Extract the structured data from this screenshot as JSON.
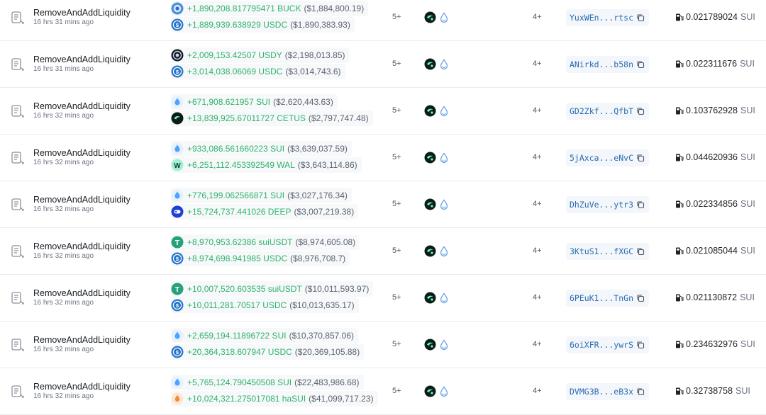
{
  "table": {
    "rows": [
      {
        "type": "RemoveAndAddLiquidity",
        "time": "16 hrs 31 mins ago",
        "changes": [
          {
            "amount": "+1,890,208.817795471 BUCK",
            "usd": "($1,884,800.19)",
            "coin": "buck"
          },
          {
            "amount": "+1,889,939.638929 USDC",
            "usd": "($1,890,383.93)",
            "coin": "usdc"
          }
        ],
        "count_a": "5+",
        "count_b": "4+",
        "sender": "YuxWEn...rtsc",
        "gas": "0.021789024",
        "gas_unit": "SUI"
      },
      {
        "type": "RemoveAndAddLiquidity",
        "time": "16 hrs 31 mins ago",
        "changes": [
          {
            "amount": "+2,009,153.42507 USDY",
            "usd": "($2,198,013.85)",
            "coin": "usdy"
          },
          {
            "amount": "+3,014,038.06069 USDC",
            "usd": "($3,014,743.6)",
            "coin": "usdc"
          }
        ],
        "count_a": "5+",
        "count_b": "4+",
        "sender": "ANirkd...b58n",
        "gas": "0.022311676",
        "gas_unit": "SUI"
      },
      {
        "type": "RemoveAndAddLiquidity",
        "time": "16 hrs 32 mins ago",
        "changes": [
          {
            "amount": "+671,908.621957 SUI",
            "usd": "($2,620,443.63)",
            "coin": "sui"
          },
          {
            "amount": "+13,839,925.67011727 CETUS",
            "usd": "($2,797,747.48)",
            "coin": "cetus"
          }
        ],
        "count_a": "5+",
        "count_b": "4+",
        "sender": "GD2Zkf...QfbT",
        "gas": "0.103762928",
        "gas_unit": "SUI"
      },
      {
        "type": "RemoveAndAddLiquidity",
        "time": "16 hrs 32 mins ago",
        "changes": [
          {
            "amount": "+933,086.561660223 SUI",
            "usd": "($3,639,037.59)",
            "coin": "sui"
          },
          {
            "amount": "+6,251,112.453392549 WAL",
            "usd": "($3,643,114.86)",
            "coin": "wal"
          }
        ],
        "count_a": "5+",
        "count_b": "4+",
        "sender": "5jAxca...eNvC",
        "gas": "0.044620936",
        "gas_unit": "SUI"
      },
      {
        "type": "RemoveAndAddLiquidity",
        "time": "16 hrs 32 mins ago",
        "changes": [
          {
            "amount": "+776,199.062566871 SUI",
            "usd": "($3,027,176.34)",
            "coin": "sui"
          },
          {
            "amount": "+15,724,737.441026 DEEP",
            "usd": "($3,007,219.38)",
            "coin": "deep"
          }
        ],
        "count_a": "5+",
        "count_b": "4+",
        "sender": "DhZuVe...ytr3",
        "gas": "0.022334856",
        "gas_unit": "SUI"
      },
      {
        "type": "RemoveAndAddLiquidity",
        "time": "16 hrs 32 mins ago",
        "changes": [
          {
            "amount": "+8,970,953.62386 suiUSDT",
            "usd": "($8,974,605.08)",
            "coin": "usdt"
          },
          {
            "amount": "+8,974,698.941985 USDC",
            "usd": "($8,976,708.7)",
            "coin": "usdc"
          }
        ],
        "count_a": "5+",
        "count_b": "4+",
        "sender": "3KtuS1...fXGC",
        "gas": "0.021085044",
        "gas_unit": "SUI"
      },
      {
        "type": "RemoveAndAddLiquidity",
        "time": "16 hrs 32 mins ago",
        "changes": [
          {
            "amount": "+10,007,520.603535 suiUSDT",
            "usd": "($10,011,593.97)",
            "coin": "usdt"
          },
          {
            "amount": "+10,011,281.70517 USDC",
            "usd": "($10,013,635.17)",
            "coin": "usdc"
          }
        ],
        "count_a": "5+",
        "count_b": "4+",
        "sender": "6PEuK1...TnGn",
        "gas": "0.021130872",
        "gas_unit": "SUI"
      },
      {
        "type": "RemoveAndAddLiquidity",
        "time": "16 hrs 32 mins ago",
        "changes": [
          {
            "amount": "+2,659,194.11896722 SUI",
            "usd": "($10,370,857.06)",
            "coin": "sui"
          },
          {
            "amount": "+20,364,318.607947 USDC",
            "usd": "($20,369,105.88)",
            "coin": "usdc"
          }
        ],
        "count_a": "5+",
        "count_b": "4+",
        "sender": "6oiXFR...ywrS",
        "gas": "0.234632976",
        "gas_unit": "SUI"
      },
      {
        "type": "RemoveAndAddLiquidity",
        "time": "16 hrs 32 mins ago",
        "changes": [
          {
            "amount": "+5,765,124.790450508 SUI",
            "usd": "($22,483,986.68)",
            "coin": "sui"
          },
          {
            "amount": "+10,024,321.275017081 haSUI",
            "usd": "($41,099,717.23)",
            "coin": "hasui"
          }
        ],
        "count_a": "5+",
        "count_b": "4+",
        "sender": "DVMG3B...eB3x",
        "gas": "0.32738758",
        "gas_unit": "SUI"
      }
    ]
  },
  "colors": {
    "positive": "#2fb36b",
    "link": "#2b6cb0",
    "muted": "#6b7280"
  },
  "icons": {
    "type": "transaction-doc-icon",
    "protocol_a": "cetus-protocol-icon",
    "protocol_b": "sui-drop-icon",
    "copy": "copy-icon",
    "gas": "fuel-pump-icon"
  }
}
